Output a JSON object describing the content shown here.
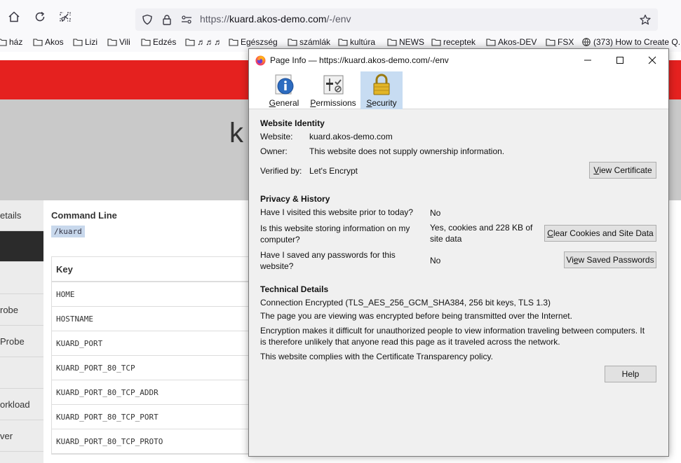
{
  "browser": {
    "url_prefix": "https://",
    "url_domain": "kuard.akos-demo.com",
    "url_path": "/-/env",
    "bookmarks": [
      "ház",
      "Akos",
      "Lizi",
      "Vili",
      "Edzés",
      "♬♬♬",
      "Egészség",
      "számlák",
      "kultúra",
      "NEWS",
      "receptek",
      "Akos-DEV",
      "FSX",
      "(373) How to Create Q..."
    ]
  },
  "page": {
    "hero_title": "k",
    "nav_items": [
      "etails",
      "",
      "",
      "robe",
      "Probe",
      "",
      "orkload",
      "ver"
    ],
    "command_line_title": "Command Line",
    "command_line_value": "/kuard",
    "table_header": "Key",
    "table_rows": [
      "HOME",
      "HOSTNAME",
      "KUARD_PORT",
      "KUARD_PORT_80_TCP",
      "KUARD_PORT_80_TCP_ADDR",
      "KUARD_PORT_80_TCP_PORT",
      "KUARD_PORT_80_TCP_PROTO"
    ]
  },
  "dialog": {
    "title": "Page Info — https://kuard.akos-demo.com/-/env",
    "tabs": [
      {
        "label": "General",
        "accel": "G",
        "rest": "eneral"
      },
      {
        "label": "Permissions",
        "accel": "P",
        "rest": "ermissions"
      },
      {
        "label": "Security",
        "accel": "S",
        "rest": "ecurity"
      }
    ],
    "identity": {
      "section_title": "Website Identity",
      "website_label": "Website:",
      "website_value": "kuard.akos-demo.com",
      "owner_label": "Owner:",
      "owner_value": "This website does not supply ownership information.",
      "verified_label": "Verified by:",
      "verified_value": "Let's Encrypt",
      "view_certificate_accel": "V",
      "view_certificate_rest": "iew Certificate"
    },
    "privacy": {
      "section_title": "Privacy & History",
      "q1": "Have I visited this website prior to today?",
      "a1": "No",
      "q2_line1": "Is this website storing information on my",
      "q2_line2": "computer?",
      "a2_line1": "Yes, cookies and 228 KB of",
      "a2_line2": "site data",
      "clear_accel": "C",
      "clear_rest": "lear Cookies and Site Data",
      "q3_line1": "Have I saved any passwords for this",
      "q3_line2": "website?",
      "a3": "No",
      "saved_pw_pre": "Vi",
      "saved_pw_accel": "e",
      "saved_pw_rest": "w Saved Passwords"
    },
    "technical": {
      "section_title": "Technical Details",
      "line1": "Connection Encrypted (TLS_AES_256_GCM_SHA384, 256 bit keys, TLS 1.3)",
      "line2": "The page you are viewing was encrypted before being transmitted over the Internet.",
      "line3a": "Encryption makes it difficult for unauthorized people to view information traveling between computers. It",
      "line3b": "is therefore unlikely that anyone read this page as it traveled across the network.",
      "line4": "This website complies with the Certificate Transparency policy."
    },
    "help_label": "Help"
  }
}
